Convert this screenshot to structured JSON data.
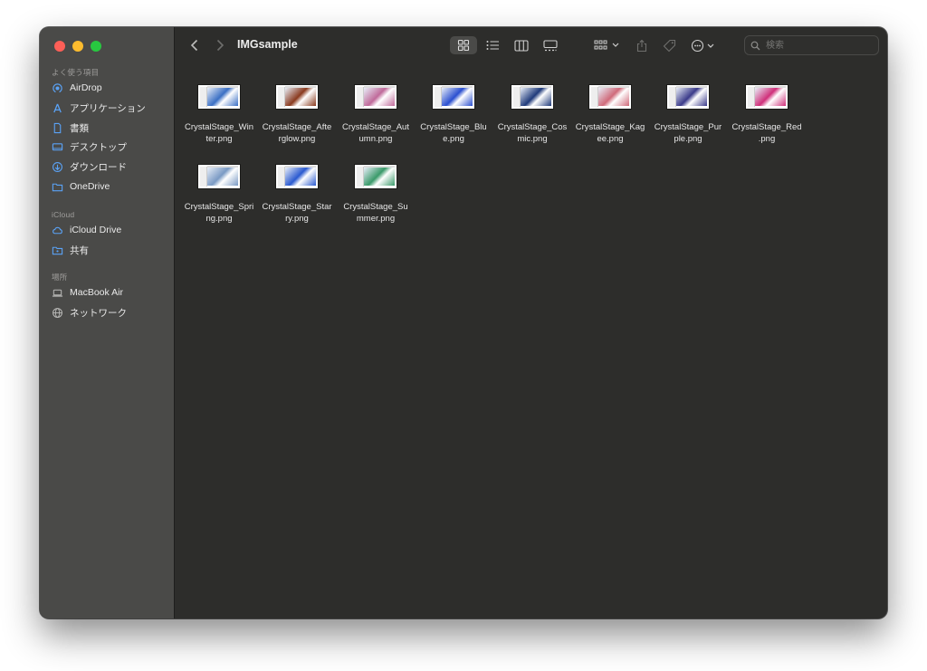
{
  "window": {
    "title": "IMGsample"
  },
  "sidebar": {
    "sections": [
      {
        "header": "よく使う項目",
        "items": [
          {
            "label": "AirDrop",
            "icon": "airdrop-icon"
          },
          {
            "label": "アプリケーション",
            "icon": "applications-icon"
          },
          {
            "label": "書類",
            "icon": "document-icon"
          },
          {
            "label": "デスクトップ",
            "icon": "desktop-icon"
          },
          {
            "label": "ダウンロード",
            "icon": "download-icon"
          },
          {
            "label": "OneDrive",
            "icon": "folder-icon"
          }
        ]
      },
      {
        "header": "iCloud",
        "items": [
          {
            "label": "iCloud Drive",
            "icon": "cloud-icon"
          },
          {
            "label": "共有",
            "icon": "shared-folder-icon"
          }
        ]
      },
      {
        "header": "場所",
        "items": [
          {
            "label": "MacBook Air",
            "icon": "laptop-icon"
          },
          {
            "label": "ネットワーク",
            "icon": "globe-icon"
          }
        ]
      }
    ]
  },
  "toolbar": {
    "search_placeholder": "検索"
  },
  "files": [
    {
      "line1": "CrystalStage_Win",
      "line2": "ter.png",
      "accent": "#3a6fc4"
    },
    {
      "line1": "CrystalStage_Afte",
      "line2": "rglow.png",
      "accent": "#8a3a1e"
    },
    {
      "line1": "CrystalStage_Aut",
      "line2": "umn.png",
      "accent": "#c06a9a"
    },
    {
      "line1": "CrystalStage_Blu",
      "line2": "e.png",
      "accent": "#2a4fd0"
    },
    {
      "line1": "CrystalStage_Cos",
      "line2": "mic.png",
      "accent": "#1f3a7a"
    },
    {
      "line1": "CrystalStage_Kag",
      "line2": "ee.png",
      "accent": "#d06a7a"
    },
    {
      "line1": "CrystalStage_Pur",
      "line2": "ple.png",
      "accent": "#3a3a8a"
    },
    {
      "line1": "CrystalStage_Red",
      "line2": ".png",
      "accent": "#d0307a"
    },
    {
      "line1": "CrystalStage_Spri",
      "line2": "ng.png",
      "accent": "#7a9ac4"
    },
    {
      "line1": "CrystalStage_Star",
      "line2": "ry.png",
      "accent": "#2a5ad0"
    },
    {
      "line1": "CrystalStage_Su",
      "line2": "mmer.png",
      "accent": "#3a9a6a"
    }
  ]
}
